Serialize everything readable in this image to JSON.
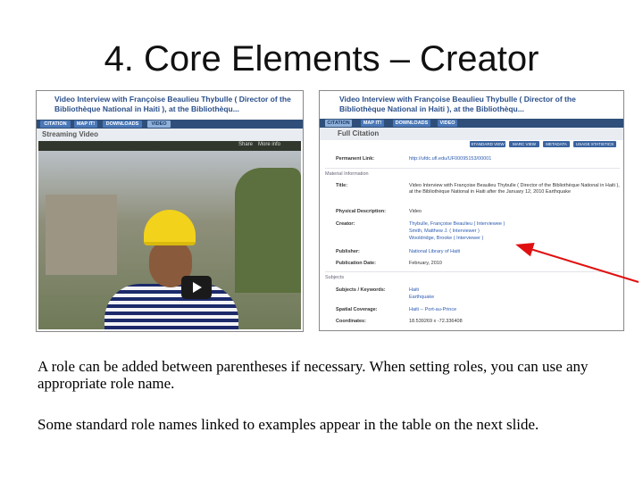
{
  "slide": {
    "title": "4. Core Elements – Creator",
    "caption1": "A role can be added between parentheses if necessary. When setting roles, you can use any appropriate role name.",
    "caption2": "Some standard role names linked to examples appear in the table on the next slide."
  },
  "left_screenshot": {
    "title": "Video Interview with Françoise Beaulieu Thybulle ( Director of the Bibliothèque National in Haiti ), at the Bibliothèqu...",
    "tabs": [
      "CITATION",
      "MAP IT!",
      "DOWNLOADS",
      "VIDEO"
    ],
    "section": "Streaming Video",
    "player": {
      "share": "Share",
      "more": "More info"
    }
  },
  "right_screenshot": {
    "title": "Video Interview with Françoise Beaulieu Thybulle ( Director of the Bibliothèque National in Haiti ), at the Bibliothèqu...",
    "tabs": [
      "CITATION",
      "MAP IT!",
      "DOWNLOADS",
      "VIDEO"
    ],
    "section": "Full Citation",
    "view_buttons": [
      "STANDARD VIEW",
      "MARC VIEW",
      "METADATA",
      "USAGE STATISTICS"
    ],
    "permanent_link_label": "Permanent Link:",
    "permanent_link_value": "http://ufdc.ufl.edu/UF00095153/00001",
    "material_info": "Material Information",
    "title_label": "Title:",
    "title_value": "Video Interview with Françoise Beaulieu Thybulle ( Director of the Bibliothèque National in Haiti ), at the Bibliothèque National in Haiti after the January 12, 2010 Earthquake",
    "physical_label": "Physical Description:",
    "physical_value": "Video",
    "creator_label": "Creator:",
    "creators": [
      "Thybulle, Françoise Beaulieu ( Interviewee )",
      "Smith, Matthew J. ( Interviewer )",
      "Wooldridge, Brooke ( Interviewer )"
    ],
    "publisher_label": "Publisher:",
    "publisher_value": "National Library of Haiti",
    "pubdate_label": "Publication Date:",
    "pubdate_value": "February, 2010",
    "subjects": "Subjects",
    "keywords_label": "Subjects / Keywords:",
    "keywords": [
      "Haiti",
      "Earthquake"
    ],
    "spatial_label": "Spatial Coverage:",
    "spatial_value": "Haiti -- Port-au-Prince",
    "coords_label": "Coordinates:",
    "coords_value": "18.539269 x -72.336408"
  },
  "colors": {
    "link": "#2a5ab0",
    "tabbar": "#2f4f7a",
    "arrow": "#e01010",
    "title_blue": "#2a4f8a"
  }
}
